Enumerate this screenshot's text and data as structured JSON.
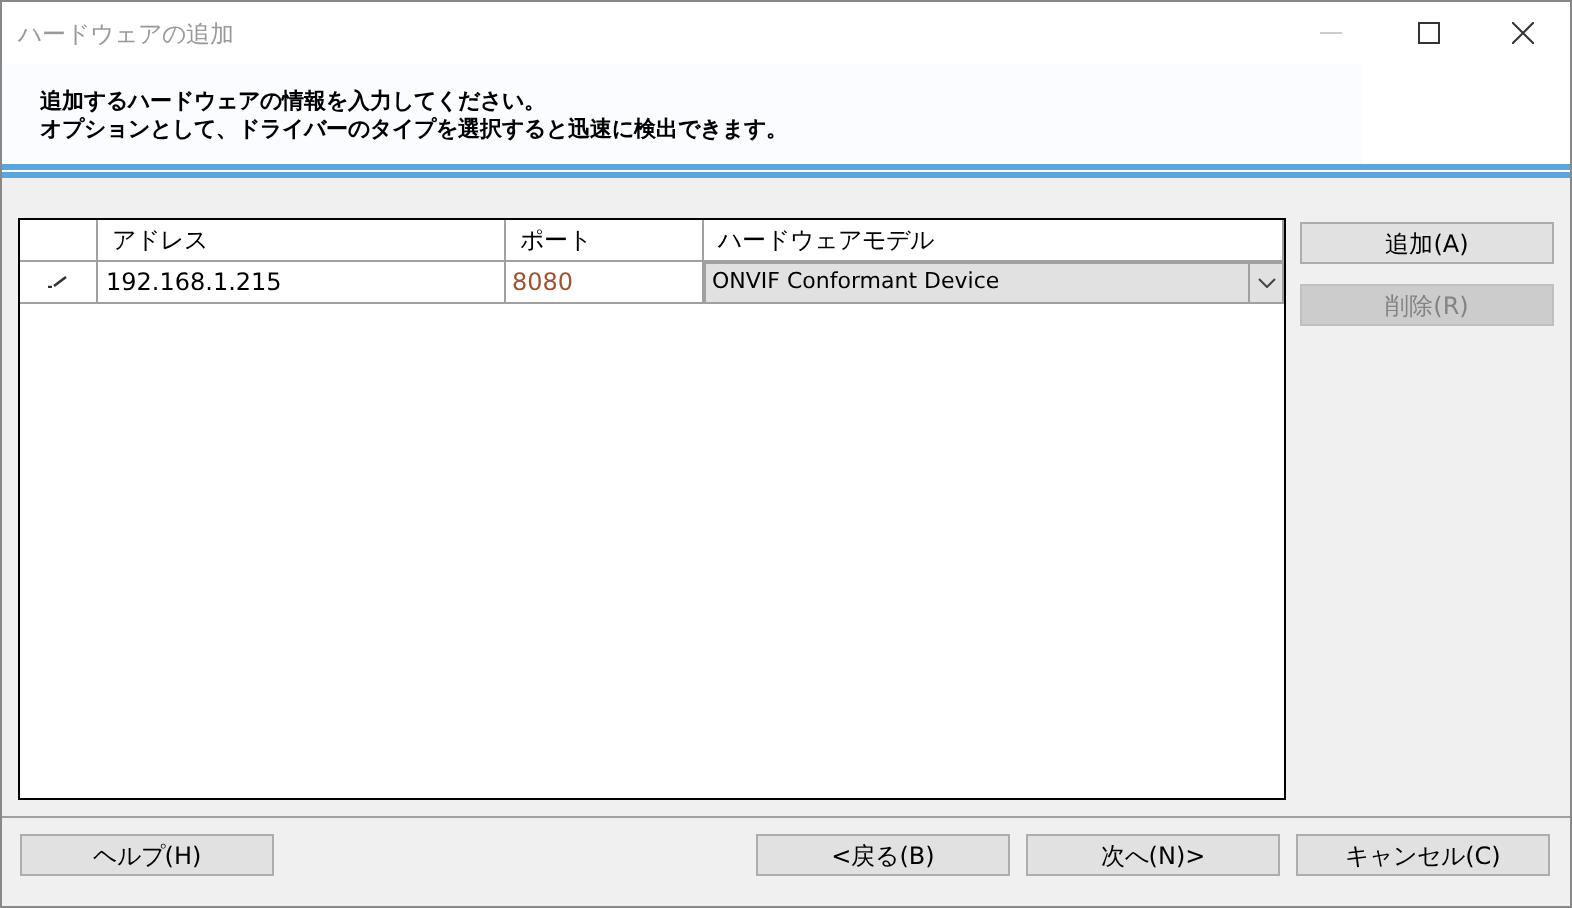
{
  "window": {
    "title": "ハードウェアの追加"
  },
  "instructions": [
    "追加するハードウェアの情報を入力してください。",
    "オプションとして、ドライバーのタイプを選択すると迅速に検出できます。"
  ],
  "table": {
    "columns": [
      "アドレス",
      "ポート",
      "ハードウェアモデル"
    ],
    "rows": [
      {
        "editing": true,
        "address": "192.168.1.215",
        "port": "8080",
        "model": "ONVIF Conformant Device"
      }
    ]
  },
  "side_buttons": [
    {
      "label": "追加(A)",
      "disabled": false
    },
    {
      "label": "削除(R)",
      "disabled": true
    }
  ],
  "footer_buttons": [
    "ヘルプ(H)",
    "<戻る(B)",
    "次へ(N)>",
    "キャンセル(C)"
  ]
}
